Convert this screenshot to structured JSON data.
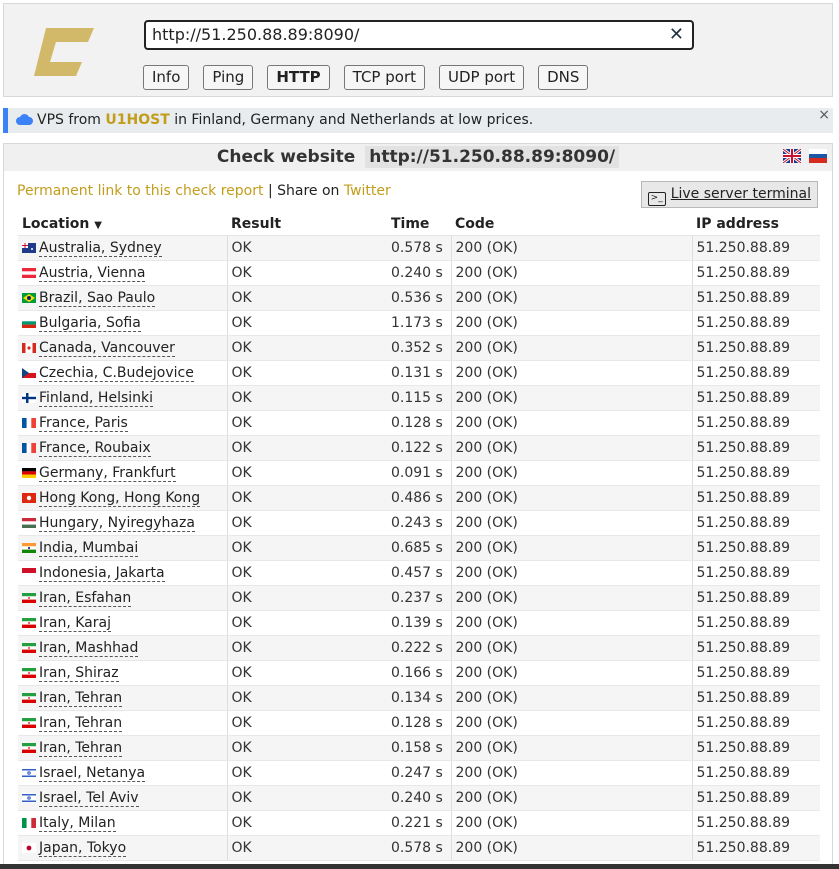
{
  "header": {
    "url": "http://51.250.88.89:8090/",
    "clear_icon": "close-icon",
    "buttons": [
      {
        "label": "Info",
        "active": false
      },
      {
        "label": "Ping",
        "active": false
      },
      {
        "label": "HTTP",
        "active": true
      },
      {
        "label": "TCP port",
        "active": false
      },
      {
        "label": "UDP port",
        "active": false
      },
      {
        "label": "DNS",
        "active": false
      }
    ],
    "logo_color": "#d2b96a"
  },
  "promo": {
    "prefix": "VPS from ",
    "brand": "U1HOST",
    "suffix": " in Finland, Germany and Netherlands at low prices.",
    "close": "×"
  },
  "panel": {
    "title": "Check website",
    "url": "http://51.250.88.89:8090/",
    "permalink": "Permanent link to this check report",
    "share_sep": " | Share on ",
    "twitter": "Twitter",
    "terminal": "Live server terminal"
  },
  "table": {
    "headers": [
      "Location",
      "Result",
      "Time",
      "Code",
      "IP address"
    ],
    "rows": [
      {
        "flag": "au",
        "location": "Australia, Sydney",
        "result": "OK",
        "time": "0.578 s",
        "code": "200 (OK)",
        "ip": "51.250.88.89"
      },
      {
        "flag": "at",
        "location": "Austria, Vienna",
        "result": "OK",
        "time": "0.240 s",
        "code": "200 (OK)",
        "ip": "51.250.88.89"
      },
      {
        "flag": "br",
        "location": "Brazil, Sao Paulo",
        "result": "OK",
        "time": "0.536 s",
        "code": "200 (OK)",
        "ip": "51.250.88.89"
      },
      {
        "flag": "bg",
        "location": "Bulgaria, Sofia",
        "result": "OK",
        "time": "1.173 s",
        "code": "200 (OK)",
        "ip": "51.250.88.89"
      },
      {
        "flag": "ca",
        "location": "Canada, Vancouver",
        "result": "OK",
        "time": "0.352 s",
        "code": "200 (OK)",
        "ip": "51.250.88.89"
      },
      {
        "flag": "cz",
        "location": "Czechia, C.Budejovice",
        "result": "OK",
        "time": "0.131 s",
        "code": "200 (OK)",
        "ip": "51.250.88.89"
      },
      {
        "flag": "fi",
        "location": "Finland, Helsinki",
        "result": "OK",
        "time": "0.115 s",
        "code": "200 (OK)",
        "ip": "51.250.88.89"
      },
      {
        "flag": "fr",
        "location": "France, Paris",
        "result": "OK",
        "time": "0.128 s",
        "code": "200 (OK)",
        "ip": "51.250.88.89"
      },
      {
        "flag": "fr",
        "location": "France, Roubaix",
        "result": "OK",
        "time": "0.122 s",
        "code": "200 (OK)",
        "ip": "51.250.88.89"
      },
      {
        "flag": "de",
        "location": "Germany, Frankfurt",
        "result": "OK",
        "time": "0.091 s",
        "code": "200 (OK)",
        "ip": "51.250.88.89"
      },
      {
        "flag": "hk",
        "location": "Hong Kong, Hong Kong",
        "result": "OK",
        "time": "0.486 s",
        "code": "200 (OK)",
        "ip": "51.250.88.89"
      },
      {
        "flag": "hu",
        "location": "Hungary, Nyiregyhaza",
        "result": "OK",
        "time": "0.243 s",
        "code": "200 (OK)",
        "ip": "51.250.88.89"
      },
      {
        "flag": "in",
        "location": "India, Mumbai",
        "result": "OK",
        "time": "0.685 s",
        "code": "200 (OK)",
        "ip": "51.250.88.89"
      },
      {
        "flag": "id",
        "location": "Indonesia, Jakarta",
        "result": "OK",
        "time": "0.457 s",
        "code": "200 (OK)",
        "ip": "51.250.88.89"
      },
      {
        "flag": "ir",
        "location": "Iran, Esfahan",
        "result": "OK",
        "time": "0.237 s",
        "code": "200 (OK)",
        "ip": "51.250.88.89"
      },
      {
        "flag": "ir",
        "location": "Iran, Karaj",
        "result": "OK",
        "time": "0.139 s",
        "code": "200 (OK)",
        "ip": "51.250.88.89"
      },
      {
        "flag": "ir",
        "location": "Iran, Mashhad",
        "result": "OK",
        "time": "0.222 s",
        "code": "200 (OK)",
        "ip": "51.250.88.89"
      },
      {
        "flag": "ir",
        "location": "Iran, Shiraz",
        "result": "OK",
        "time": "0.166 s",
        "code": "200 (OK)",
        "ip": "51.250.88.89"
      },
      {
        "flag": "ir",
        "location": "Iran, Tehran",
        "result": "OK",
        "time": "0.134 s",
        "code": "200 (OK)",
        "ip": "51.250.88.89"
      },
      {
        "flag": "ir",
        "location": "Iran, Tehran",
        "result": "OK",
        "time": "0.128 s",
        "code": "200 (OK)",
        "ip": "51.250.88.89"
      },
      {
        "flag": "ir",
        "location": "Iran, Tehran",
        "result": "OK",
        "time": "0.158 s",
        "code": "200 (OK)",
        "ip": "51.250.88.89"
      },
      {
        "flag": "il",
        "location": "Israel, Netanya",
        "result": "OK",
        "time": "0.247 s",
        "code": "200 (OK)",
        "ip": "51.250.88.89"
      },
      {
        "flag": "il",
        "location": "Israel, Tel Aviv",
        "result": "OK",
        "time": "0.240 s",
        "code": "200 (OK)",
        "ip": "51.250.88.89"
      },
      {
        "flag": "it",
        "location": "Italy, Milan",
        "result": "OK",
        "time": "0.221 s",
        "code": "200 (OK)",
        "ip": "51.250.88.89"
      },
      {
        "flag": "jp",
        "location": "Japan, Tokyo",
        "result": "OK",
        "time": "0.578 s",
        "code": "200 (OK)",
        "ip": "51.250.88.89"
      }
    ]
  },
  "colors": {
    "accent_gold": "#c29d1b",
    "promo_bar": "#3b82f6"
  }
}
